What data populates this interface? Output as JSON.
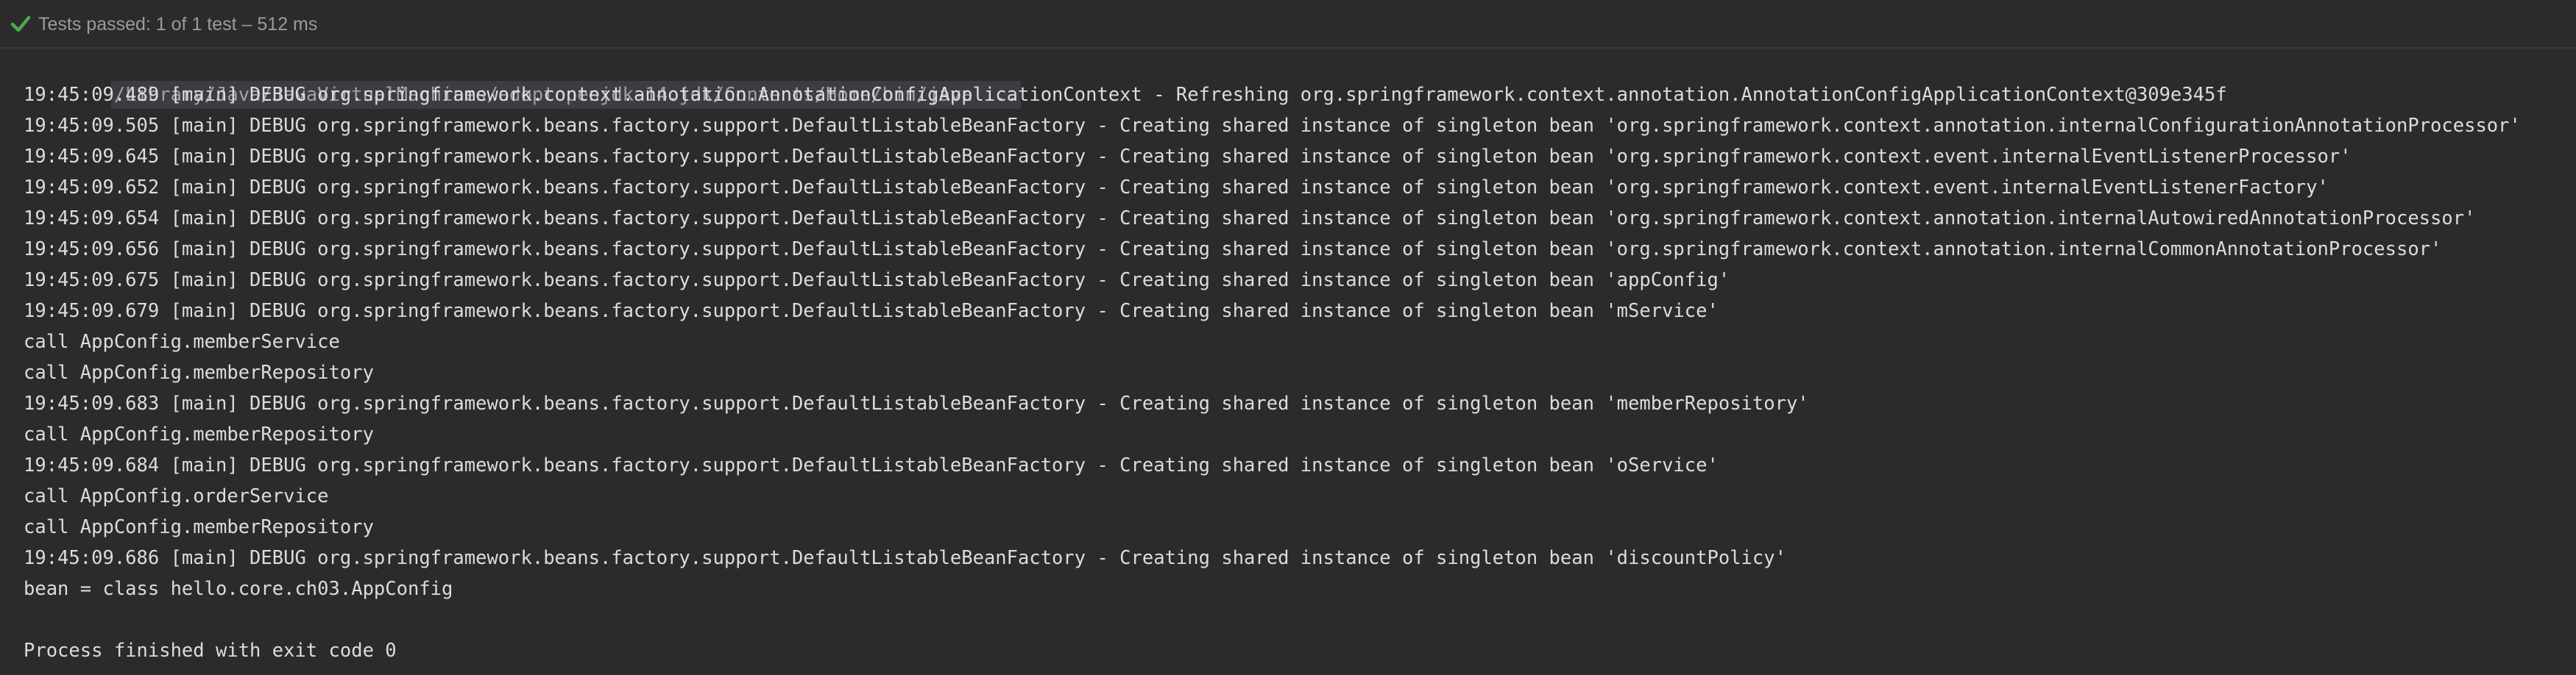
{
  "status": {
    "icon": "checkmark-icon",
    "text": "Tests passed: 1 of 1 test – 512 ms",
    "icon_color": "#4ea94b"
  },
  "console": {
    "command_line": "/Library/Java/JavaVirtualMachines/adoptopenjdk-14.jdk/Contents/Home/bin/java ...",
    "lines": [
      "19:45:09.489 [main] DEBUG org.springframework.context.annotation.AnnotationConfigApplicationContext - Refreshing org.springframework.context.annotation.AnnotationConfigApplicationContext@309e345f",
      "19:45:09.505 [main] DEBUG org.springframework.beans.factory.support.DefaultListableBeanFactory - Creating shared instance of singleton bean 'org.springframework.context.annotation.internalConfigurationAnnotationProcessor'",
      "19:45:09.645 [main] DEBUG org.springframework.beans.factory.support.DefaultListableBeanFactory - Creating shared instance of singleton bean 'org.springframework.context.event.internalEventListenerProcessor'",
      "19:45:09.652 [main] DEBUG org.springframework.beans.factory.support.DefaultListableBeanFactory - Creating shared instance of singleton bean 'org.springframework.context.event.internalEventListenerFactory'",
      "19:45:09.654 [main] DEBUG org.springframework.beans.factory.support.DefaultListableBeanFactory - Creating shared instance of singleton bean 'org.springframework.context.annotation.internalAutowiredAnnotationProcessor'",
      "19:45:09.656 [main] DEBUG org.springframework.beans.factory.support.DefaultListableBeanFactory - Creating shared instance of singleton bean 'org.springframework.context.annotation.internalCommonAnnotationProcessor'",
      "19:45:09.675 [main] DEBUG org.springframework.beans.factory.support.DefaultListableBeanFactory - Creating shared instance of singleton bean 'appConfig'",
      "19:45:09.679 [main] DEBUG org.springframework.beans.factory.support.DefaultListableBeanFactory - Creating shared instance of singleton bean 'mService'",
      "call AppConfig.memberService",
      "call AppConfig.memberRepository",
      "19:45:09.683 [main] DEBUG org.springframework.beans.factory.support.DefaultListableBeanFactory - Creating shared instance of singleton bean 'memberRepository'",
      "call AppConfig.memberRepository",
      "19:45:09.684 [main] DEBUG org.springframework.beans.factory.support.DefaultListableBeanFactory - Creating shared instance of singleton bean 'oService'",
      "call AppConfig.orderService",
      "call AppConfig.memberRepository",
      "19:45:09.686 [main] DEBUG org.springframework.beans.factory.support.DefaultListableBeanFactory - Creating shared instance of singleton bean 'discountPolicy'",
      "bean = class hello.core.ch03.AppConfig",
      "",
      "Process finished with exit code 0"
    ]
  }
}
